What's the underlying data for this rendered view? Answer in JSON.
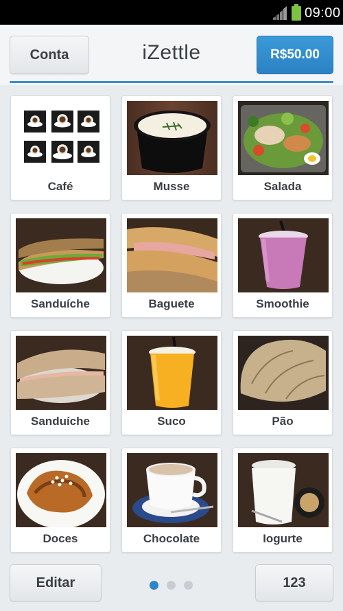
{
  "status_bar": {
    "time": "09:00"
  },
  "header": {
    "account_label": "Conta",
    "brand": "iZettle",
    "total_label": "R$50.00"
  },
  "products": [
    {
      "label": "Café",
      "photo": "coffee-cups-icon"
    },
    {
      "label": "Musse",
      "photo": "mousse-bowl-icon"
    },
    {
      "label": "Salada",
      "photo": "salad-icon"
    },
    {
      "label": "Sanduíche",
      "photo": "sandwich-icon"
    },
    {
      "label": "Baguete",
      "photo": "baguette-icon"
    },
    {
      "label": "Smoothie",
      "photo": "smoothie-cup-icon"
    },
    {
      "label": "Sanduíche",
      "photo": "sandwich-roll-icon"
    },
    {
      "label": "Suco",
      "photo": "juice-cup-icon"
    },
    {
      "label": "Pão",
      "photo": "bread-loaf-icon"
    },
    {
      "label": "Doces",
      "photo": "pastry-icon"
    },
    {
      "label": "Chocolate",
      "photo": "hot-chocolate-icon"
    },
    {
      "label": "Iogurte",
      "photo": "yogurt-cup-icon"
    }
  ],
  "footer": {
    "edit_label": "Editar",
    "keypad_label": "123",
    "page_count": 3,
    "active_page": 1
  },
  "colors": {
    "accent": "#2d86c8",
    "total_button": "#3a9ad7",
    "background": "#e9ecef"
  }
}
